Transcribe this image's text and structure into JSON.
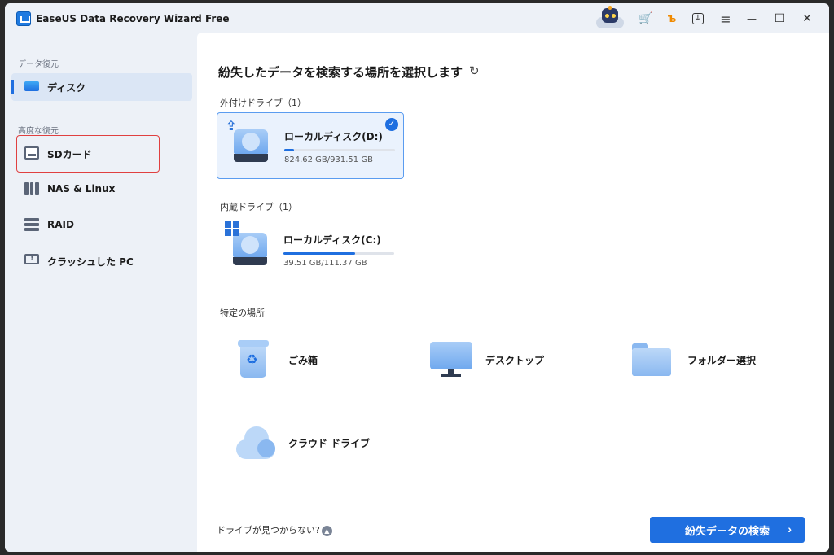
{
  "titlebar": {
    "title": "EaseUS Data Recovery Wizard Free",
    "icons": [
      "app-logo-icon",
      "assistant-robot-icon",
      "cart-icon",
      "key-icon",
      "download-icon",
      "menu-icon",
      "minimize-icon",
      "maximize-icon",
      "close-icon"
    ],
    "menu_glyph": "≡",
    "minimize_glyph": "—",
    "maximize_glyph": "☐",
    "close_glyph": "✕",
    "cart_glyph": "🛒",
    "key_glyph": "ъ",
    "download_glyph": "↓"
  },
  "sidebar": {
    "section1": "データ復元",
    "disk_label": "ディスク",
    "section2": "高度な復元",
    "sd_label": "SDカード",
    "nas_label": "NAS & Linux",
    "raid_label": "RAID",
    "crash_label": "クラッシュした PC"
  },
  "main": {
    "title": "紛失したデータを検索する場所を選択します",
    "refresh_glyph": "↻",
    "external_label": "外付けドライブ（1）",
    "internal_label": "内蔵ドライブ（1）",
    "drives": {
      "d": {
        "name": "ローカルディスク(D:)",
        "size": "824.62 GB/931.51 GB",
        "usage": 0.09,
        "check": "✓"
      },
      "c": {
        "name": "ローカルディスク(C:)",
        "size": "39.51 GB/111.37 GB",
        "usage": 0.65
      }
    },
    "specific_label": "特定の場所",
    "locations": {
      "trash": "ごみ箱",
      "desktop": "デスクトップ",
      "folder": "フォルダー選択",
      "cloud": "クラウド ドライブ"
    },
    "trash_glyph": "♻",
    "usb_glyph": "⇪"
  },
  "footer": {
    "not_found": "ドライブが見つからない?",
    "up_glyph": "▲",
    "scan_button": "紛失データの検索",
    "chevron": "›"
  },
  "colors": {
    "accent": "#1f6fe0",
    "highlight_border": "#e04040"
  }
}
